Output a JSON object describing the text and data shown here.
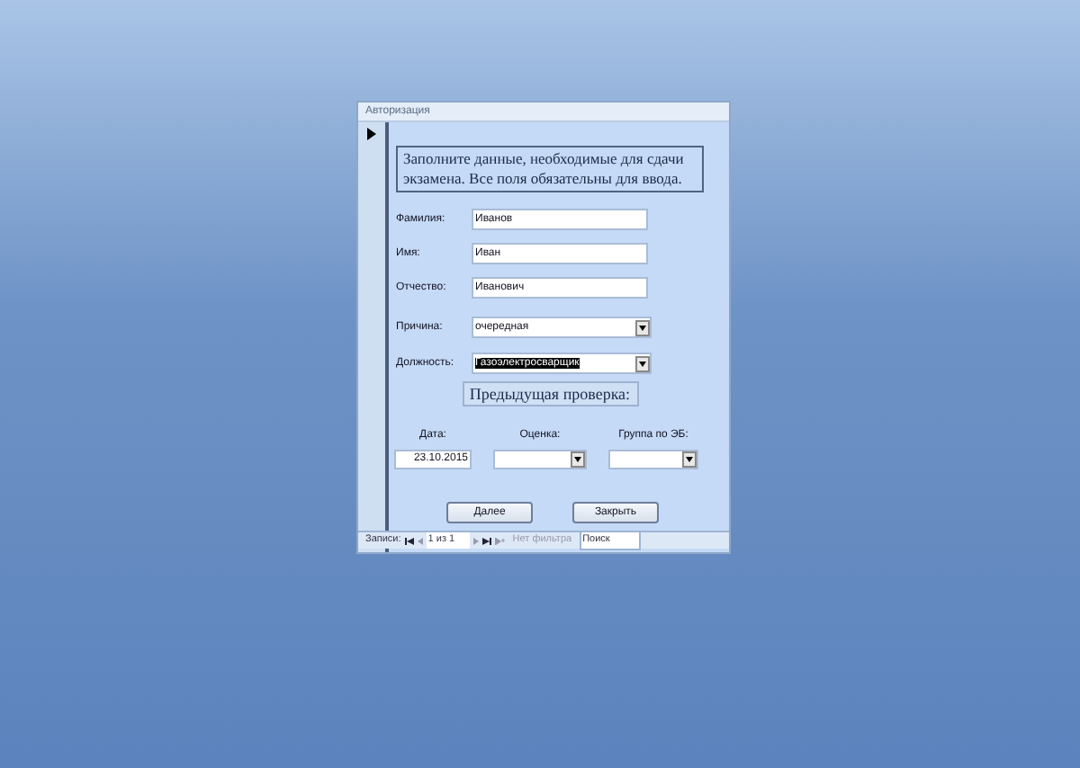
{
  "window": {
    "title": "Авторизация"
  },
  "header_text": "Заполните данные, необходимые для сдачи экзамена. Все поля обязательны для ввода.",
  "fields": [
    {
      "label": "Фамилия:",
      "value": "Иванов",
      "kind": "text",
      "highlighted": false
    },
    {
      "label": "Имя:",
      "value": "Иван",
      "kind": "text",
      "highlighted": false
    },
    {
      "label": "Отчество:",
      "value": "Иванович",
      "kind": "text",
      "highlighted": false
    },
    {
      "label": "Причина:",
      "value": "очередная",
      "kind": "combo",
      "highlighted": false
    },
    {
      "label": "Должность:",
      "value": "Газоэлектросварщик",
      "kind": "combo",
      "highlighted": true
    }
  ],
  "previous_check": {
    "title": "Предыдущая проверка:"
  },
  "check_fields": [
    {
      "label": "Дата:",
      "value": "23.10.2015",
      "kind": "text"
    },
    {
      "label": "Оценка:",
      "kind": "combo"
    },
    {
      "label": "Группа по ЭБ:",
      "kind": "combo"
    }
  ],
  "buttons": [
    "Далее",
    "Закрыть"
  ],
  "navigator": {
    "label": "Записи:",
    "position": "1 из 1",
    "filter": "Нет фильтра",
    "search": "Поиск"
  }
}
